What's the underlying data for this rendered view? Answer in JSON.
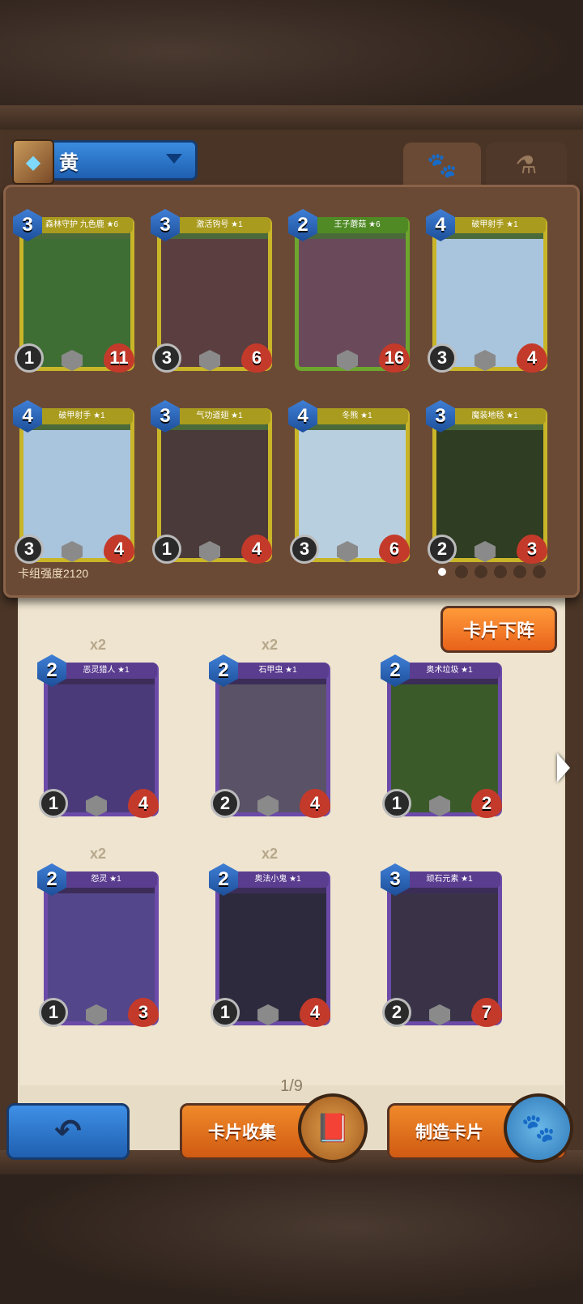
{
  "header": {
    "deck_color_label": "黄",
    "tabs": [
      "paw-tab",
      "potion-tab"
    ]
  },
  "deck": {
    "power_label": "卡组强度2120",
    "cards": [
      {
        "title": "森林守护 九色鹿 ★6",
        "cost": "3",
        "attack": "1",
        "health": "11",
        "style": "gold",
        "art": "#3f6e34"
      },
      {
        "title": "激活钩号 ★1",
        "cost": "3",
        "attack": "3",
        "health": "6",
        "style": "gold",
        "art": "#5b3f40"
      },
      {
        "title": "王子蘑菇 ★6",
        "cost": "2",
        "attack": "",
        "health": "16",
        "style": "green",
        "art": "#6a4a5a"
      },
      {
        "title": "破甲射手 ★1",
        "cost": "4",
        "attack": "3",
        "health": "4",
        "style": "gold",
        "art": "#a9c4dd"
      },
      {
        "title": "破甲射手 ★1",
        "cost": "4",
        "attack": "3",
        "health": "4",
        "style": "gold",
        "art": "#a9c4dd"
      },
      {
        "title": "气功道翅 ★1",
        "cost": "3",
        "attack": "1",
        "health": "4",
        "style": "gold",
        "art": "#4a3a3a"
      },
      {
        "title": "冬熊 ★1",
        "cost": "4",
        "attack": "3",
        "health": "6",
        "style": "gold",
        "art": "#b8cfe0"
      },
      {
        "title": "魔装地毯 ★1",
        "cost": "3",
        "attack": "2",
        "health": "3",
        "style": "gold",
        "art": "#2f3d22"
      }
    ]
  },
  "remove_button_label": "卡片下阵",
  "collection": {
    "cards": [
      {
        "title": "恶灵猎人 ★1",
        "cost": "2",
        "attack": "1",
        "health": "4",
        "copies": "x2",
        "art": "#4a3a7a"
      },
      {
        "title": "石甲虫 ★1",
        "cost": "2",
        "attack": "2",
        "health": "4",
        "copies": "x2",
        "art": "#5a5266"
      },
      {
        "title": "奥术垃圾 ★1",
        "cost": "2",
        "attack": "1",
        "health": "2",
        "copies": "",
        "art": "#3a5a2a"
      },
      {
        "title": "怨灵 ★1",
        "cost": "2",
        "attack": "1",
        "health": "3",
        "copies": "x2",
        "art": "#54468a"
      },
      {
        "title": "奥法小鬼 ★1",
        "cost": "2",
        "attack": "1",
        "health": "4",
        "copies": "x2",
        "art": "#2e2a3e"
      },
      {
        "title": "顽石元素 ★1",
        "cost": "3",
        "attack": "2",
        "health": "7",
        "copies": "",
        "art": "#3a3348"
      }
    ],
    "page_indicator": "1/9"
  },
  "footer": {
    "back_icon": "↶",
    "collect_label": "卡片收集",
    "craft_label": "制造卡片"
  }
}
